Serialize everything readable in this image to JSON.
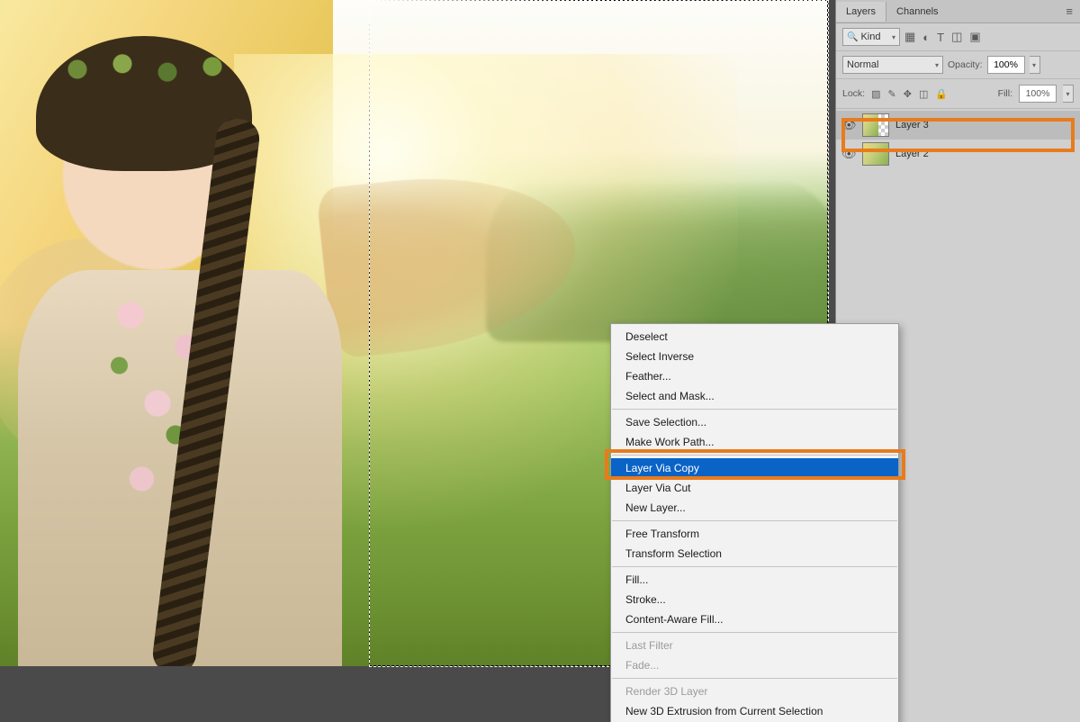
{
  "panel": {
    "tabs": {
      "layers": "Layers",
      "channels": "Channels"
    },
    "filter": {
      "label": "Kind"
    },
    "blend": {
      "mode": "Normal",
      "opacity_label": "Opacity:",
      "opacity_value": "100%"
    },
    "lock": {
      "label": "Lock:",
      "fill_label": "Fill:",
      "fill_value": "100%"
    },
    "layer_items": [
      {
        "name": "Layer 3"
      },
      {
        "name": "Layer 2"
      }
    ]
  },
  "context_menu": {
    "groups": [
      [
        {
          "label": "Deselect",
          "disabled": false
        },
        {
          "label": "Select Inverse",
          "disabled": false
        },
        {
          "label": "Feather...",
          "disabled": false
        },
        {
          "label": "Select and Mask...",
          "disabled": false
        }
      ],
      [
        {
          "label": "Save Selection...",
          "disabled": false
        },
        {
          "label": "Make Work Path...",
          "disabled": false
        }
      ],
      [
        {
          "label": "Layer Via Copy",
          "disabled": false,
          "selected": true
        },
        {
          "label": "Layer Via Cut",
          "disabled": false
        },
        {
          "label": "New Layer...",
          "disabled": false
        }
      ],
      [
        {
          "label": "Free Transform",
          "disabled": false
        },
        {
          "label": "Transform Selection",
          "disabled": false
        }
      ],
      [
        {
          "label": "Fill...",
          "disabled": false
        },
        {
          "label": "Stroke...",
          "disabled": false
        },
        {
          "label": "Content-Aware Fill...",
          "disabled": false
        }
      ],
      [
        {
          "label": "Last Filter",
          "disabled": true
        },
        {
          "label": "Fade...",
          "disabled": true
        }
      ],
      [
        {
          "label": "Render 3D Layer",
          "disabled": true
        },
        {
          "label": "New 3D Extrusion from Current Selection",
          "disabled": false
        }
      ]
    ]
  }
}
